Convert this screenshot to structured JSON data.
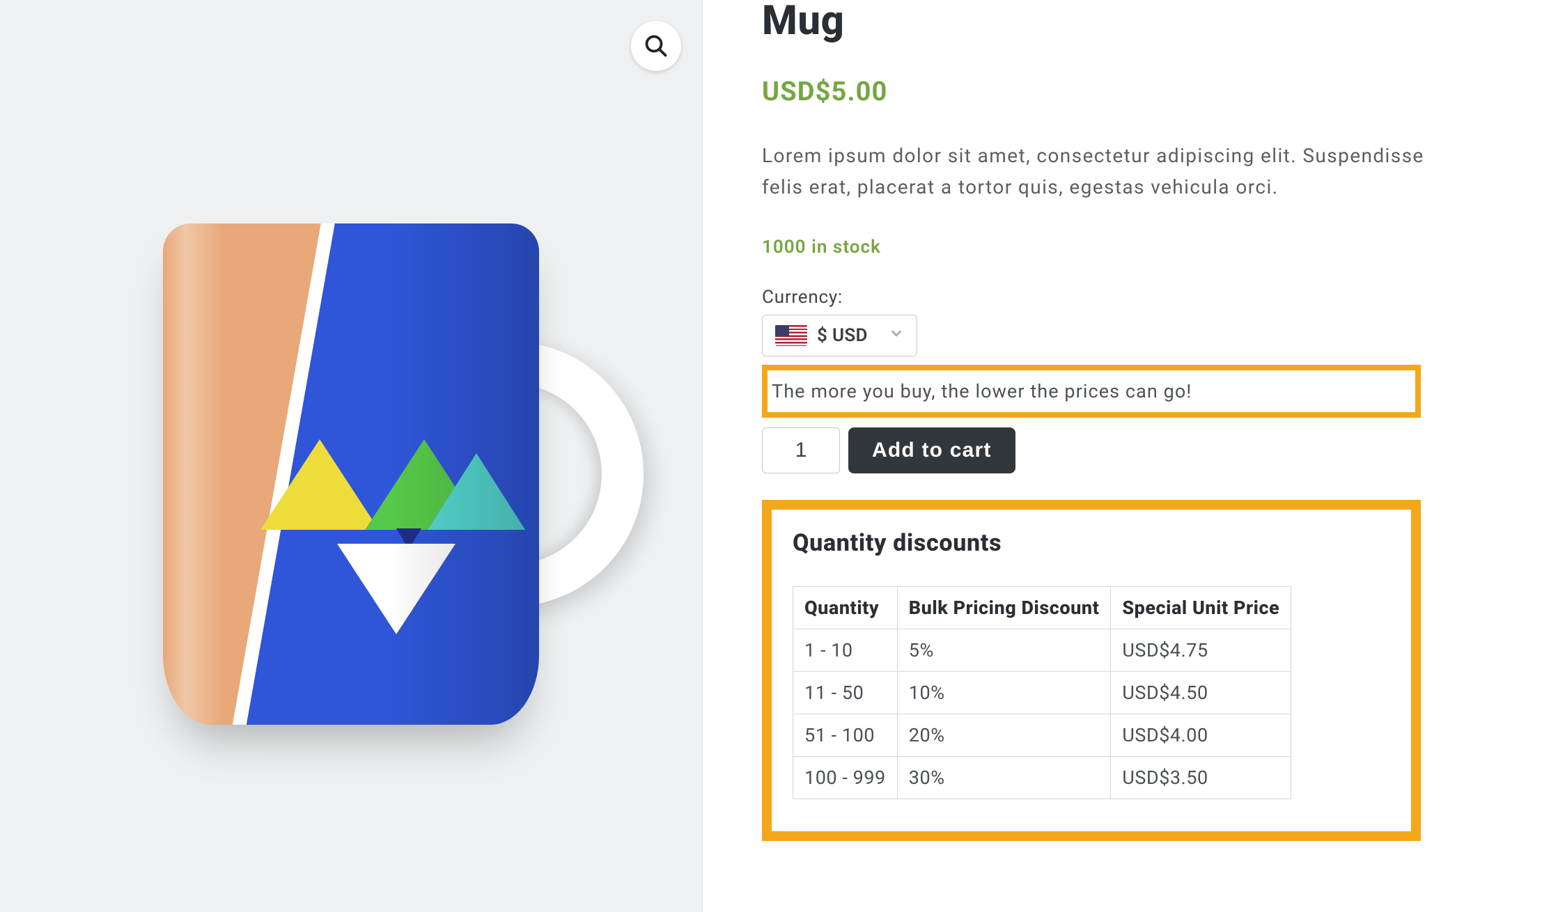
{
  "product": {
    "title": "Mug",
    "price": "USD$5.00",
    "description": "Lorem ipsum dolor sit amet, consectetur adipiscing elit. Suspendisse felis erat, placerat a tortor quis, egestas vehicula orci.",
    "stock": "1000 in stock"
  },
  "currency": {
    "label": "Currency:",
    "selected": "$ USD"
  },
  "promo": {
    "text": "The more you buy, the lower the prices can go!"
  },
  "cart": {
    "quantity_value": "1",
    "add_label": "Add to cart"
  },
  "discounts": {
    "title": "Quantity discounts",
    "headers": [
      "Quantity",
      "Bulk Pricing Discount",
      "Special Unit Price"
    ],
    "rows": [
      {
        "qty": "1 - 10",
        "disc": "5%",
        "price": "USD$4.75"
      },
      {
        "qty": "11 - 50",
        "disc": "10%",
        "price": "USD$4.50"
      },
      {
        "qty": "51 - 100",
        "disc": "20%",
        "price": "USD$4.00"
      },
      {
        "qty": "100 - 999",
        "disc": "30%",
        "price": "USD$3.50"
      }
    ]
  }
}
